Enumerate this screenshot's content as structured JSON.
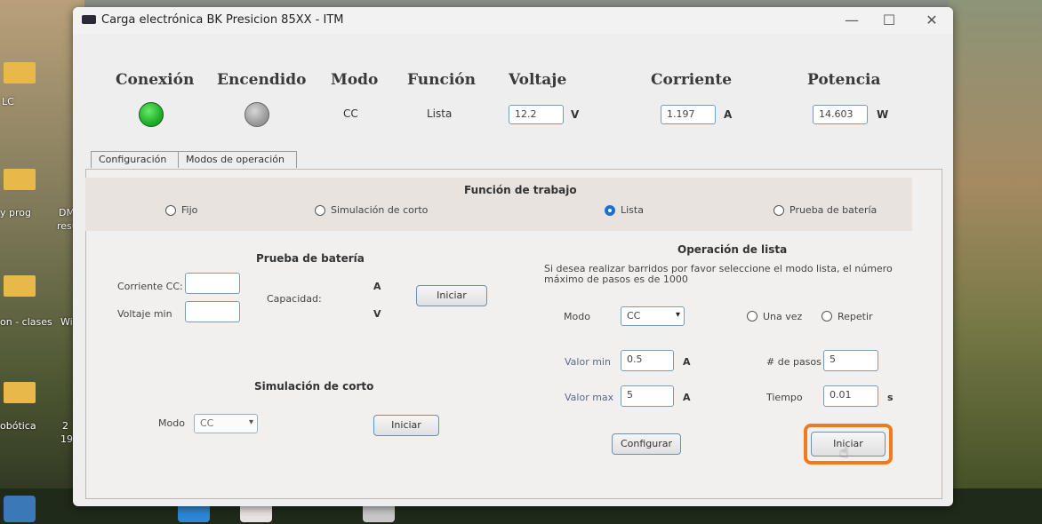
{
  "window": {
    "title": "Carga electrónica BK Presicion 85XX - ITM",
    "minimize": "—",
    "maximize": "☐",
    "close": "✕"
  },
  "desktop": {
    "labels": [
      "LC",
      "y prog",
      "DM",
      "resu",
      "on - clases",
      "Wi",
      "obótica",
      "2",
      "19"
    ]
  },
  "header": {
    "conexion": "Conexión",
    "encendido": "Encendido",
    "modo": "Modo",
    "funcion": "Función",
    "voltaje": "Voltaje",
    "corriente": "Corriente",
    "potencia": "Potencia",
    "modo_value": "CC",
    "funcion_value": "Lista",
    "voltaje_value": "12.2",
    "voltaje_unit": "V",
    "corriente_value": "1.197",
    "corriente_unit": "A",
    "potencia_value": "14.603",
    "potencia_unit": "W",
    "conexion_color": "#22b02a",
    "encendido_color": "#9c9c9c"
  },
  "tabs": [
    "Configuración",
    "Modos de operación"
  ],
  "funcion_trabajo": {
    "title": "Función de trabajo",
    "options": [
      "Fijo",
      "Simulación de corto",
      "Lista",
      "Prueba de batería"
    ],
    "selected": "Lista"
  },
  "bateria": {
    "title": "Prueba de batería",
    "corriente_label": "Corriente CC:",
    "voltaje_label": "Voltaje min",
    "capacidad_label": "Capacidad:",
    "unit_a": "A",
    "unit_v": "V",
    "start": "Iniciar"
  },
  "corto": {
    "title": "Simulación de corto",
    "modo_label": "Modo",
    "modo_value": "CC",
    "start": "Iniciar"
  },
  "lista": {
    "title": "Operación de lista",
    "info": "Si desea realizar barridos por favor seleccione el modo lista, el número máximo de pasos es de 1000",
    "modo_label": "Modo",
    "modo_value": "CC",
    "una_vez": "Una vez",
    "repetir": "Repetir",
    "valor_min_label": "Valor min",
    "valor_min": "0.5",
    "valor_max_label": "Valor max",
    "valor_max": "5",
    "unit_a": "A",
    "pasos_label": "# de pasos",
    "pasos": "5",
    "tiempo_label": "Tiempo",
    "tiempo": "0.01",
    "tiempo_unit": "s",
    "configurar": "Configurar",
    "start": "Iniciar"
  },
  "accent_color": "#f07a1e"
}
